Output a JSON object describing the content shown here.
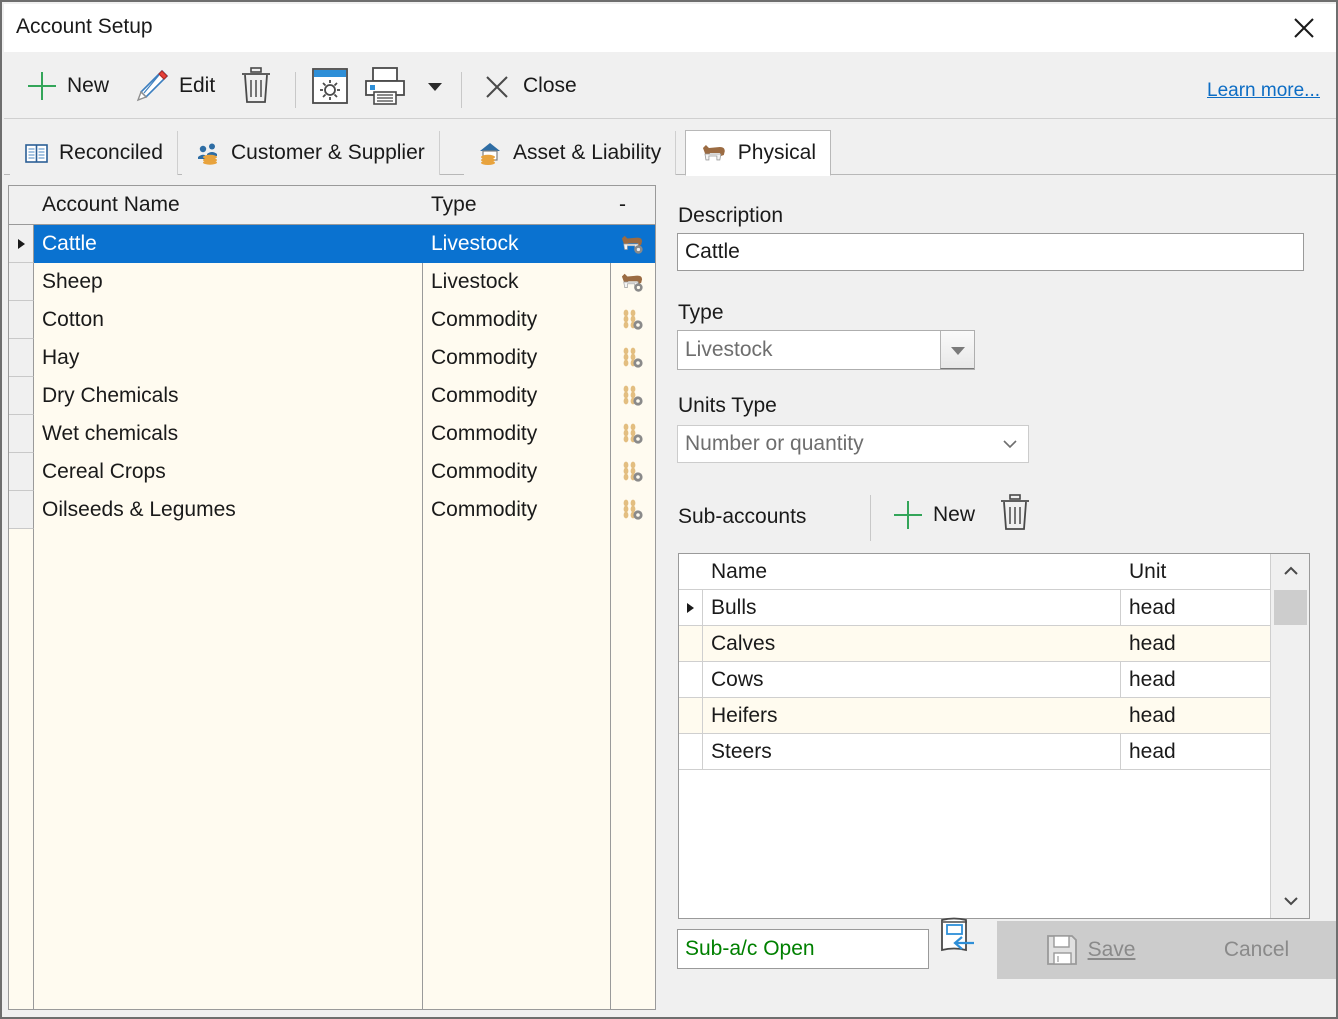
{
  "window": {
    "title": "Account Setup",
    "close_icon": "close-icon"
  },
  "toolbar": {
    "new_label": "New",
    "edit_label": "Edit",
    "delete_icon": "trash-icon",
    "settings_icon": "gear-window-icon",
    "print_icon": "printer-icon",
    "print_dropdown_icon": "chevron-down-icon",
    "close_label": "Close",
    "learn_more_label": "Learn more..."
  },
  "tabs": [
    {
      "label": "Reconciled",
      "icon": "book-icon",
      "active": false
    },
    {
      "label": "Customer & Supplier",
      "icon": "people-coins-icon",
      "active": false
    },
    {
      "label": "Asset & Liability",
      "icon": "house-coins-icon",
      "active": false
    },
    {
      "label": "Physical",
      "icon": "cow-icon",
      "active": true
    }
  ],
  "accounts_grid": {
    "columns": [
      "Account Name",
      "Type",
      "-"
    ],
    "rows": [
      {
        "name": "Cattle",
        "type": "Livestock",
        "icon": "cow-gear-icon",
        "selected": true
      },
      {
        "name": "Sheep",
        "type": "Livestock",
        "icon": "sheep-gear-icon",
        "selected": false
      },
      {
        "name": "Cotton",
        "type": "Commodity",
        "icon": "wheat-gear-icon",
        "selected": false
      },
      {
        "name": "Hay",
        "type": "Commodity",
        "icon": "wheat-gear-icon",
        "selected": false
      },
      {
        "name": "Dry Chemicals",
        "type": "Commodity",
        "icon": "wheat-gear-icon",
        "selected": false
      },
      {
        "name": "Wet chemicals",
        "type": "Commodity",
        "icon": "wheat-gear-icon",
        "selected": false
      },
      {
        "name": "Cereal Crops",
        "type": "Commodity",
        "icon": "wheat-gear-icon",
        "selected": false
      },
      {
        "name": "Oilseeds & Legumes",
        "type": "Commodity",
        "icon": "wheat-gear-icon",
        "selected": false
      }
    ]
  },
  "details": {
    "description_label": "Description",
    "description_value": "Cattle",
    "type_label": "Type",
    "type_value": "Livestock",
    "units_type_label": "Units Type",
    "units_type_value": "Number or quantity",
    "sub_accounts_label": "Sub-accounts",
    "sub_new_label": "New",
    "sub_delete_icon": "trash-icon"
  },
  "sub_accounts_grid": {
    "columns": [
      "Name",
      "Unit"
    ],
    "rows": [
      {
        "name": "Bulls",
        "unit": "head",
        "selected": true
      },
      {
        "name": "Calves",
        "unit": "head",
        "selected": false
      },
      {
        "name": "Cows",
        "unit": "head",
        "selected": false
      },
      {
        "name": "Heifers",
        "unit": "head",
        "selected": false
      },
      {
        "name": "Steers",
        "unit": "head",
        "selected": false
      }
    ],
    "scroll_up_icon": "chevron-up-icon",
    "scroll_down_icon": "chevron-down-icon"
  },
  "footer": {
    "sub_ac_open_label": "Sub-a/c Open",
    "sub_ac_open_icon": "book-arrow-icon",
    "save_label": "Save",
    "save_icon": "floppy-icon",
    "cancel_label": "Cancel"
  },
  "colors": {
    "accent_blue": "#0a72d0",
    "link_blue": "#0d6dc4",
    "grid_cream": "#fffbf0",
    "green_text": "#008000",
    "window_bg": "#f0f0f0"
  }
}
